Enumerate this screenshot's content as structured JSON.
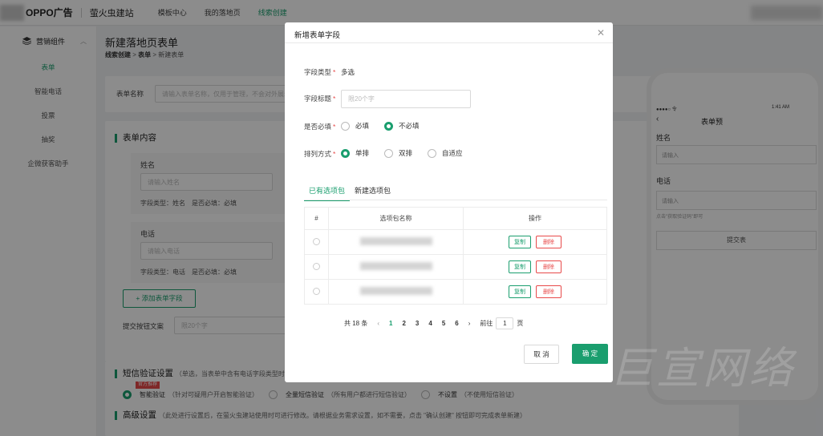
{
  "topbar": {
    "logo": "OPPO广告",
    "brand": "萤火虫建站",
    "nav": [
      "模板中心",
      "我的落地页",
      "线索创建"
    ],
    "active_nav_index": 2
  },
  "sidebar": {
    "group": "营销组件",
    "items": [
      "表单",
      "智能电话",
      "投票",
      "抽奖",
      "企微获客助手"
    ],
    "active_index": 0
  },
  "page": {
    "title": "新建落地页表单",
    "breadcrumb": [
      "线索创建",
      "表单",
      "新建表单"
    ]
  },
  "bg": {
    "form_name_label": "表单名称",
    "form_name_placeholder": "请输入表单名称，仅用于管理，不会对外展示",
    "content_title": "表单内容",
    "fields": [
      {
        "title": "姓名",
        "placeholder": "请输入姓名",
        "meta": "字段类型：姓名　是否必填：必填"
      },
      {
        "title": "电话",
        "placeholder": "请输入电话",
        "meta": "字段类型：电话　是否必填：必填"
      }
    ],
    "add_field": "+ 添加表单字段",
    "submit_label": "提交按钮文案",
    "submit_placeholder": "限20个字",
    "sms_title": "短信验证设置",
    "sms_hint": "（单选，当表单中含有电话字段类型时",
    "sms_badge": "官方推荐",
    "sms_options": [
      {
        "label": "智能验证",
        "hint": "（针对可疑用户开启智能验证）"
      },
      {
        "label": "全量短信验证",
        "hint": "（所有用户都进行短信验证）"
      },
      {
        "label": "不设置",
        "hint": "（不使用短信验证）"
      }
    ],
    "adv_title": "高级设置",
    "adv_hint": "（此处进行设置后，在萤火虫建站使用时可进行修改。请根据业务需求设置，如不需要，点击 \"确认创建\" 按钮即可完成表单新建）"
  },
  "phone": {
    "status": "●●●●○ 令",
    "time": "1:41 AM",
    "title": "表单预",
    "fields": [
      {
        "label": "姓名",
        "placeholder": "请输入"
      },
      {
        "label": "电话",
        "placeholder": "请输入"
      }
    ],
    "hint": "点击\"获取验证码\"即可",
    "submit": "提交表"
  },
  "modal": {
    "title": "新增表单字段",
    "type_label": "字段类型",
    "type_value": "多选",
    "title_label": "字段标题",
    "title_placeholder": "限20个字",
    "required_label": "是否必填",
    "required_options": [
      "必填",
      "不必填"
    ],
    "required_selected": 1,
    "layout_label": "排列方式",
    "layout_options": [
      "单排",
      "双排",
      "自适应"
    ],
    "layout_selected": 0,
    "tabs": [
      "已有选项包",
      "新建选项包"
    ],
    "active_tab": 0,
    "table": {
      "headers": [
        "#",
        "选项包名称",
        "操作"
      ],
      "rows": [
        {
          "copy": "复制",
          "delete": "删除"
        },
        {
          "copy": "复制",
          "delete": "删除"
        },
        {
          "copy": "复制",
          "delete": "删除"
        }
      ]
    },
    "pager": {
      "total": "共 18 条",
      "prev": "‹",
      "pages": [
        "1",
        "2",
        "3",
        "4",
        "5",
        "6"
      ],
      "current": "1",
      "next": "›",
      "goto_label": "前往",
      "goto_value": "1",
      "goto_unit": "页"
    },
    "cancel": "取 消",
    "ok": "确 定"
  },
  "watermark": "巨宣网络",
  "colors": {
    "accent": "#1a9e6e",
    "danger": "#e84a4a"
  }
}
